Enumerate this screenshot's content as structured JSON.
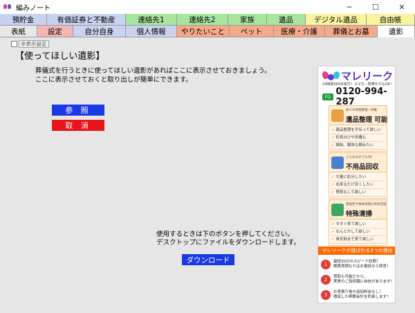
{
  "window": {
    "title": "編みノート",
    "minimize": "─",
    "maximize": "☐",
    "close": "✕"
  },
  "tabs_row1": [
    {
      "label": "預貯金",
      "color": "#c9d2f0"
    },
    {
      "label": "有価証券と不動産",
      "color": "#c9d2f0"
    },
    {
      "label": "連絡先1",
      "color": "#a8e6a0"
    },
    {
      "label": "連絡先2",
      "color": "#a8e6a0"
    },
    {
      "label": "家族",
      "color": "#a8e6a0"
    },
    {
      "label": "遺品",
      "color": "#a8e6a0"
    },
    {
      "label": "デジタル遺品",
      "color": "#f8f4a0"
    },
    {
      "label": "自由帳",
      "color": "#f8f4a0"
    }
  ],
  "tabs_row2": [
    {
      "label": "表紙",
      "color": "#e8e8e8"
    },
    {
      "label": "設定",
      "color": "#f2b6b6"
    },
    {
      "label": "自分自身",
      "color": "#c9d2f0"
    },
    {
      "label": "個人情報",
      "color": "#c9d2f0"
    },
    {
      "label": "やりたいこと",
      "color": "#f4a98a"
    },
    {
      "label": "ペット",
      "color": "#f4a98a"
    },
    {
      "label": "医療・介護",
      "color": "#f4a98a"
    },
    {
      "label": "葬儀とお墓",
      "color": "#f4a98a"
    },
    {
      "label": "遺影",
      "color": "#ffffff"
    }
  ],
  "main": {
    "hide_checkbox_label": "非表示設定",
    "heading": "【使ってほしい遺影】",
    "description_line1": "葬儀式を行うときに使ってほしい遺影があればここに表示させておきましょう。",
    "description_line2": "ここに表示させておくと取り出しが簡単にできます。",
    "reference_button": "参 照",
    "cancel_button": "取 消",
    "note_line1": "使用するときは下のボタンを押してください。",
    "note_line2": "デスクトップにファイルをダウンロードします。",
    "download_button": "ダウンロード"
  },
  "ad": {
    "brand": "マレリーク",
    "tagline": "24時間365日受付！スマホ・携帯からもOK！",
    "freedial": "FD",
    "phone": "0120-994-287",
    "services": [
      {
        "sub": "故人の荷物整理・供養",
        "title": "遺品整理 可能",
        "icon_color": "#e8a040",
        "items": [
          "遺品整理を手伝って欲しい",
          "形見分けや供養も",
          "掃除、解体も頼みたい"
        ]
      },
      {
        "sub": "どんなものでもOK",
        "title": "不用品回収",
        "icon_color": "#4a7fd0",
        "items": [
          "大量に処分したい",
          "出来るだけ安くしたい",
          "買取もして欲しい"
        ]
      },
      {
        "sub": "孤独死や事故現場の原状回復",
        "title": "特殊清掃",
        "icon_color": "#3aa860",
        "items": [
          "今すぐ来て欲しい",
          "なんとかして欲しい",
          "臭気剤まで来て欲しい"
        ]
      }
    ],
    "why_title": "マレリークが選ばれる3つの理由",
    "reasons": [
      {
        "num": "1",
        "line1": "最短30分のスピード訪問！",
        "line2": "概算見積もりはお電話なら即答！"
      },
      {
        "num": "2",
        "line1": "買取も可能だから、",
        "line2": "実質のご負担額に自信があります！"
      },
      {
        "num": "3",
        "line1": "お見積り後の追加料金なし！",
        "line2": "徹底した明朗会計を約束します！"
      }
    ]
  }
}
